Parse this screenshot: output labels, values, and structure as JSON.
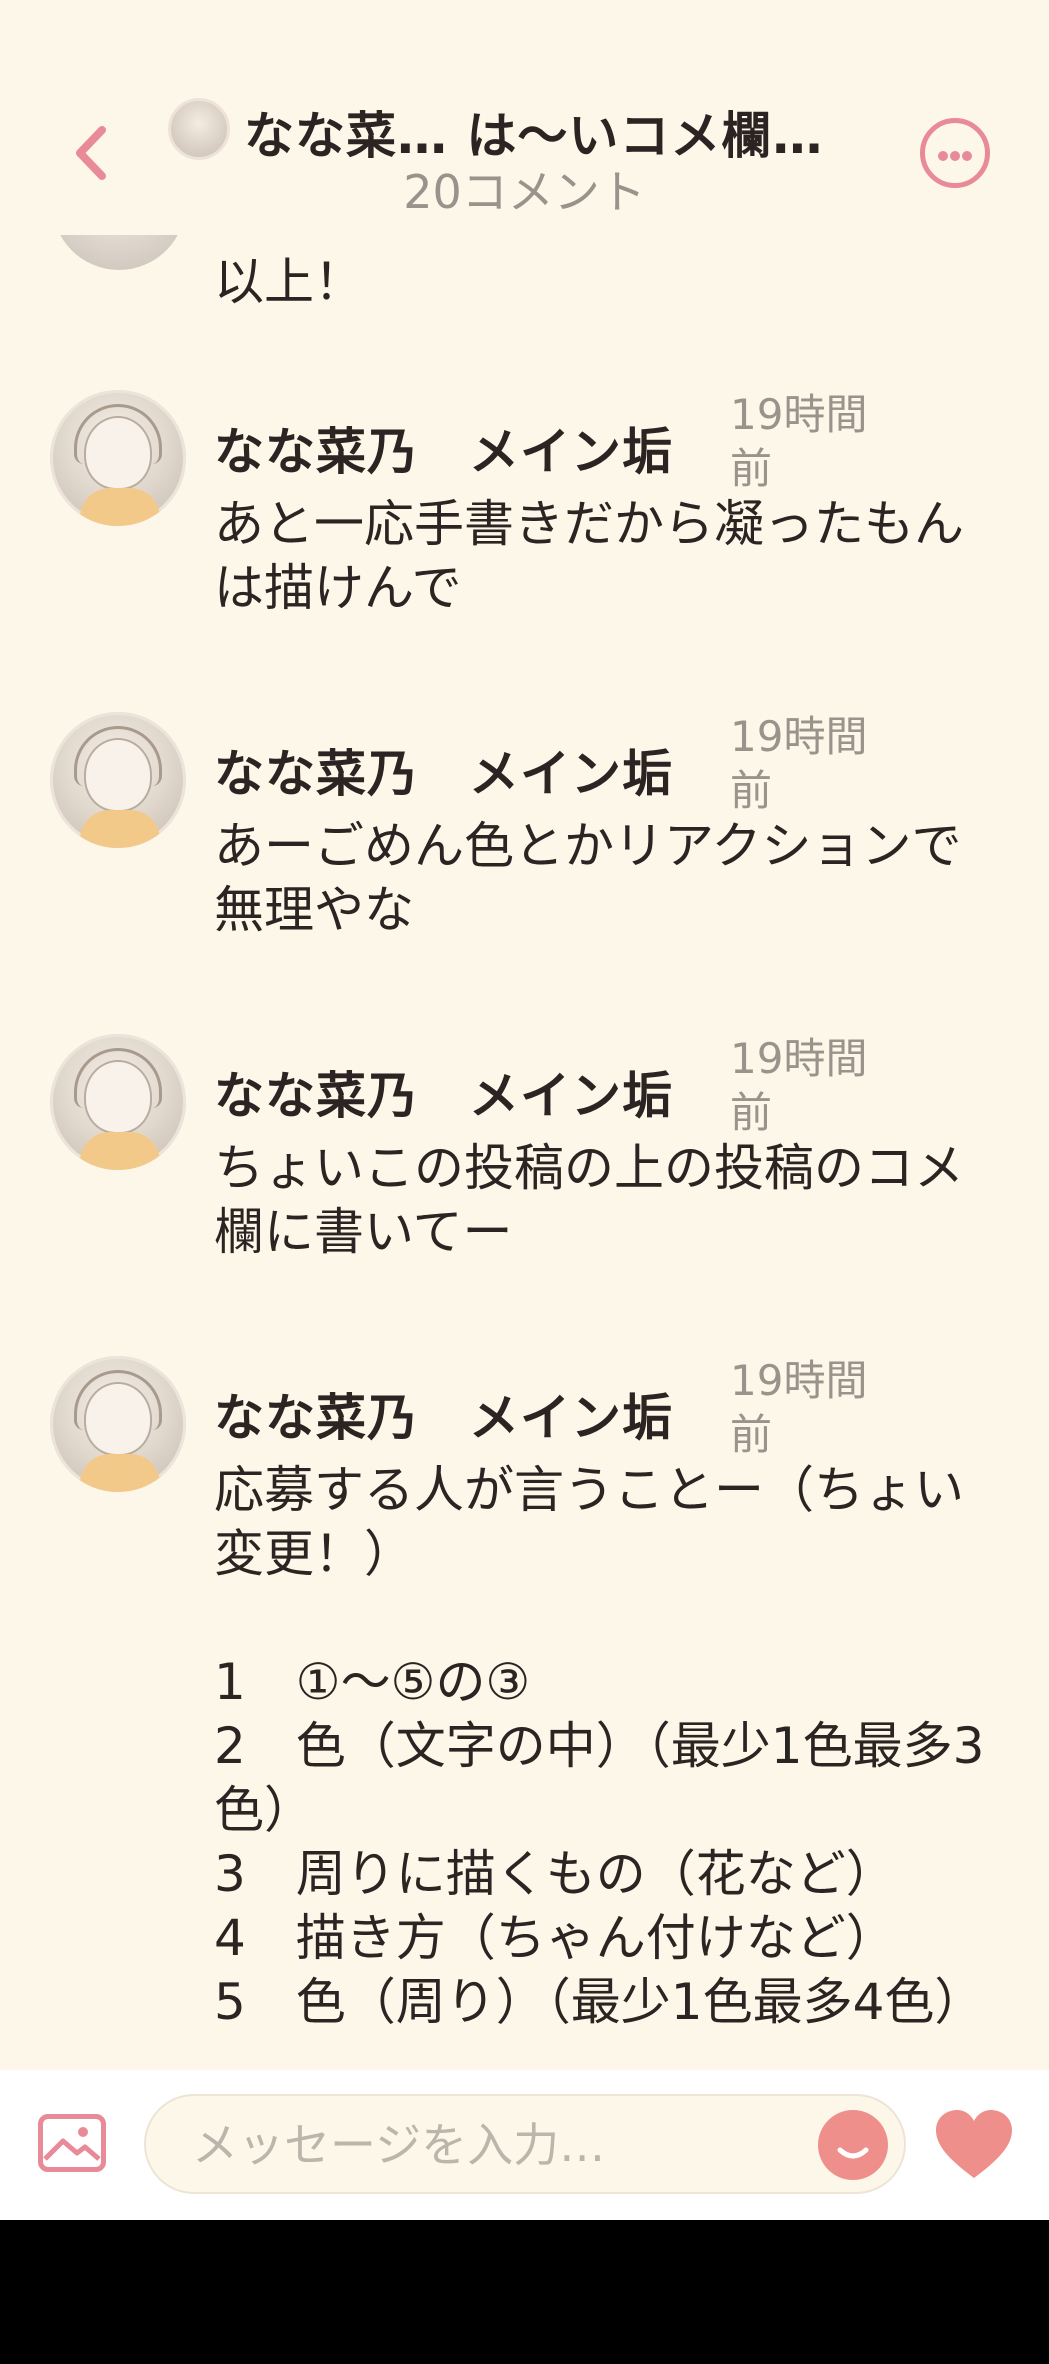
{
  "header": {
    "title": "なな菜… は〜いコメ欄…",
    "subtitle": "20コメント",
    "icons": {
      "back": "chevron-left-icon",
      "more": "more-horizontal-icon"
    }
  },
  "feed": {
    "partial_comment_text": "以上！",
    "comments": [
      {
        "author": "なな菜乃　メイン垢",
        "time": "19時間前",
        "text": "あと一応手書きだから凝ったもんは描けんで"
      },
      {
        "author": "なな菜乃　メイン垢",
        "time": "19時間前",
        "text": "あーごめん色とかリアクションで無理やな"
      },
      {
        "author": "なな菜乃　メイン垢",
        "time": "19時間前",
        "text": "ちょいこの投稿の上の投稿のコメ欄に書いてー"
      },
      {
        "author": "なな菜乃　メイン垢",
        "time": "19時間前",
        "text": "応募する人が言うことー（ちょい変更！）\n\n1　①〜⑤の③\n2　色（文字の中）（最少1色最多3色）\n3　周りに描くもの（花など）\n4　描き方（ちゃん付けなど）\n5　色（周り）（最少1色最多4色）"
      }
    ]
  },
  "composer": {
    "placeholder": "メッセージを入力…",
    "icons": {
      "image": "image-icon",
      "emoji": "smile-icon",
      "like": "heart-icon"
    }
  },
  "colors": {
    "accent": "#e88a98",
    "background": "#fdf7ea",
    "muted_text": "#9a928b"
  }
}
